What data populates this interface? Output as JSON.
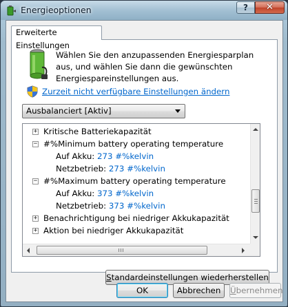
{
  "window": {
    "title": "Energieoptionen",
    "help_label": "?",
    "close_label": "✕"
  },
  "tab": {
    "label": "Erweiterte Einstellungen"
  },
  "intro": {
    "text": "Wählen Sie den anzupassenden Energiesparplan aus, und wählen Sie dann die gewünschten Energiespareinstellungen aus."
  },
  "link": {
    "label": "Zurzeit nicht verfügbare Einstellungen ändern"
  },
  "plan_select": {
    "value": "Ausbalanciert [Aktiv]"
  },
  "tree": {
    "rows": [
      {
        "expander": "+",
        "label": "Kritische Batteriekapazität"
      },
      {
        "expander": "−",
        "label": "#%Minimum battery operating temperature"
      },
      {
        "label": "Auf Akku:",
        "value": "273 #%kelvin"
      },
      {
        "label": "Netzbetrieb:",
        "value": "273 #%kelvin"
      },
      {
        "expander": "−",
        "label": "#%Maximum battery operating temperature"
      },
      {
        "label": "Auf Akku:",
        "value": "373 #%kelvin"
      },
      {
        "label": "Netzbetrieb:",
        "value": "373 #%kelvin"
      },
      {
        "expander": "+",
        "label": "Benachrichtigung bei niedriger Akkukapazität"
      },
      {
        "expander": "+",
        "label": "Aktion bei niedriger Akkukapazität"
      }
    ]
  },
  "buttons": {
    "restore_prefix": "",
    "restore_underlined": "S",
    "restore_rest": "tandardeinstellungen wiederherstellen",
    "ok": "OK",
    "cancel": "Abbrechen",
    "apply_underlined": "Ü",
    "apply_rest": "bernehmen"
  },
  "colors": {
    "link": "#0066cc",
    "setting_value": "#0066cc",
    "close_button": "#c0442a"
  },
  "icons": {
    "app": "power-options-icon",
    "battery": "battery-plug-icon",
    "uac": "uac-shield-icon"
  }
}
